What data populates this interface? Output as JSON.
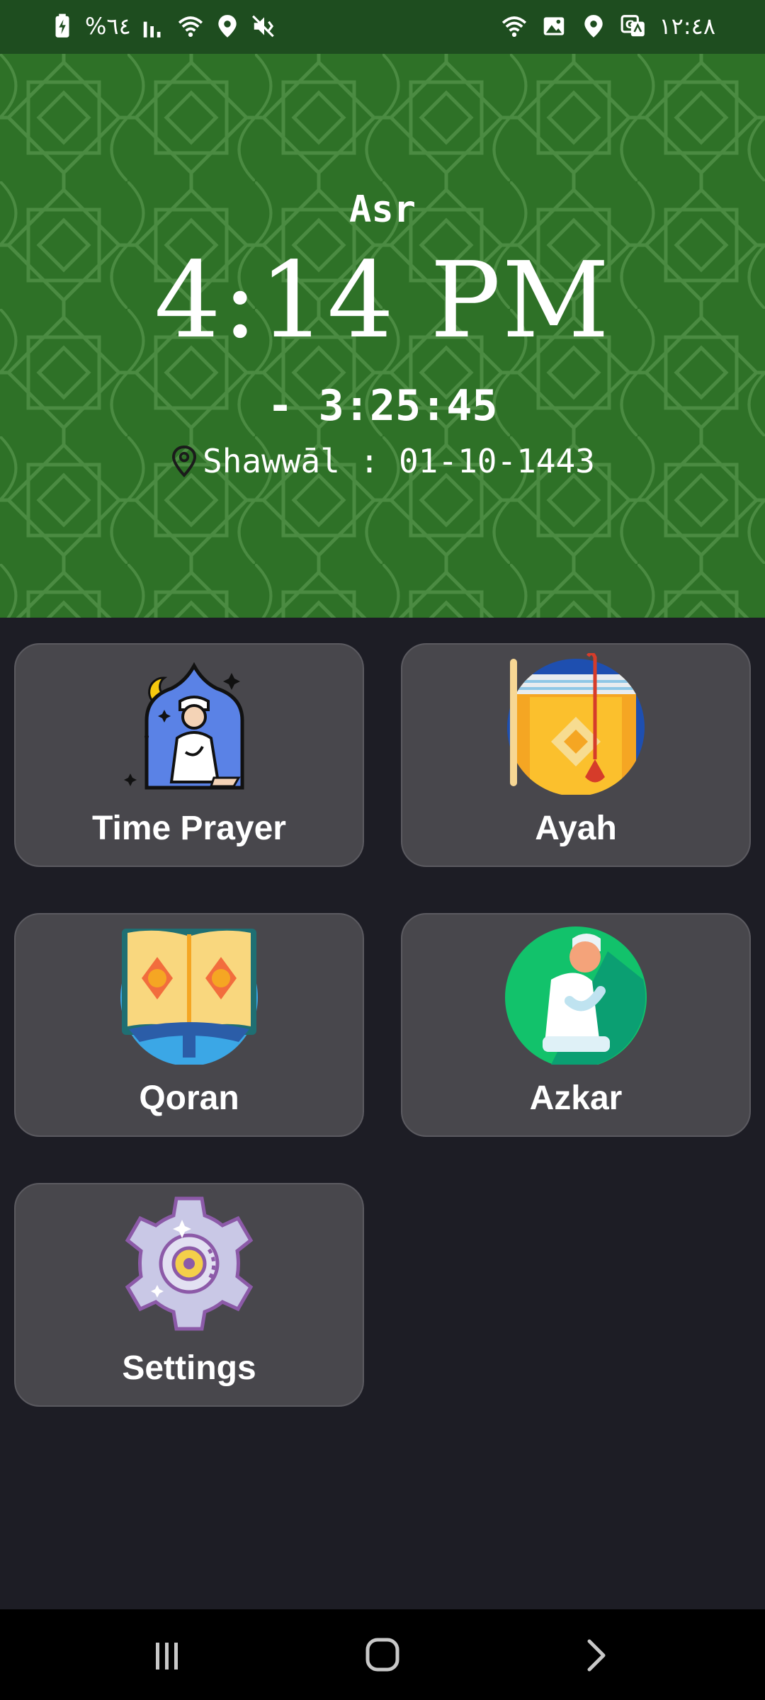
{
  "status_bar": {
    "battery": "%٦٤",
    "clock": "١٢:٤٨",
    "left_icons": [
      "battery-charging-icon",
      "signal-icon",
      "wifi-icon",
      "location-icon",
      "mute-icon"
    ],
    "right_icons": [
      "wifi-icon",
      "image-icon",
      "location-icon",
      "translate-icon"
    ]
  },
  "header": {
    "prayer_name": "Asr",
    "prayer_time": "4:14 PM",
    "countdown": "- 3:25:45",
    "hijri_date": "Shawwāl : 01-10-1443",
    "location_icon": "location-pin-icon",
    "background_color": "#2e7127"
  },
  "menu": {
    "items": [
      {
        "label": "Time Prayer",
        "icon": "praying-man-mosque-icon"
      },
      {
        "label": "Ayah",
        "icon": "quran-book-icon"
      },
      {
        "label": "Qoran",
        "icon": "open-quran-icon"
      },
      {
        "label": "Azkar",
        "icon": "worshipper-icon"
      },
      {
        "label": "Settings",
        "icon": "gear-icon"
      }
    ]
  },
  "nav_bar": {
    "buttons": [
      "recent-apps-icon",
      "home-icon",
      "back-icon"
    ]
  }
}
